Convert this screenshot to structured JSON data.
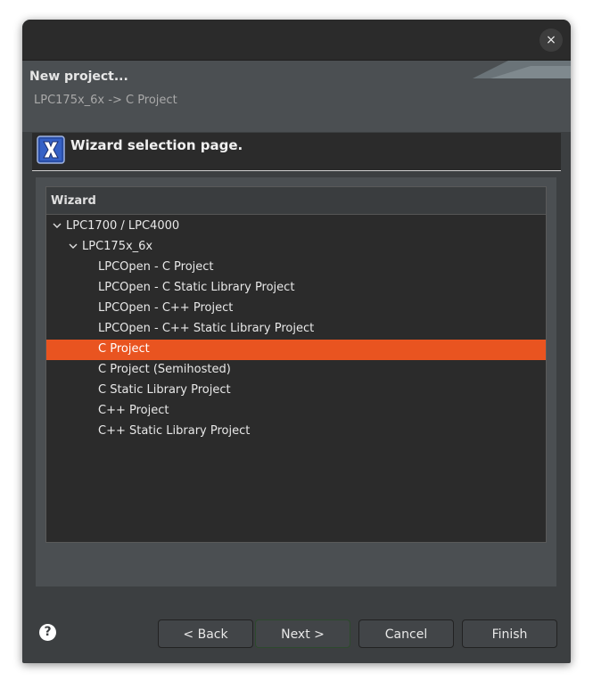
{
  "window": {
    "close_label": "×"
  },
  "header": {
    "title": "New project...",
    "subtitle": "LPC175x_6x -> C Project"
  },
  "page": {
    "title": "Wizard selection page."
  },
  "tree": {
    "column_header": "Wizard",
    "items": [
      {
        "label": "LPC1700 / LPC4000",
        "level": 0,
        "expanded": true
      },
      {
        "label": "LPC175x_6x",
        "level": 1,
        "expanded": true
      },
      {
        "label": "LPCOpen - C Project",
        "level": 2
      },
      {
        "label": "LPCOpen - C Static Library Project",
        "level": 2
      },
      {
        "label": "LPCOpen - C++ Project",
        "level": 2
      },
      {
        "label": "LPCOpen - C++ Static Library Project",
        "level": 2
      },
      {
        "label": "C Project",
        "level": 2,
        "selected": true
      },
      {
        "label": "C Project (Semihosted)",
        "level": 2
      },
      {
        "label": "C Static Library Project",
        "level": 2
      },
      {
        "label": "C++ Project",
        "level": 2
      },
      {
        "label": "C++ Static Library Project",
        "level": 2
      }
    ]
  },
  "buttons": {
    "help_icon": "?",
    "back": "< Back",
    "next": "Next >",
    "cancel": "Cancel",
    "finish": "Finish"
  },
  "colors": {
    "selection": "#e95420",
    "background": "#3c3f41",
    "title_bar": "#2b2b2b"
  }
}
